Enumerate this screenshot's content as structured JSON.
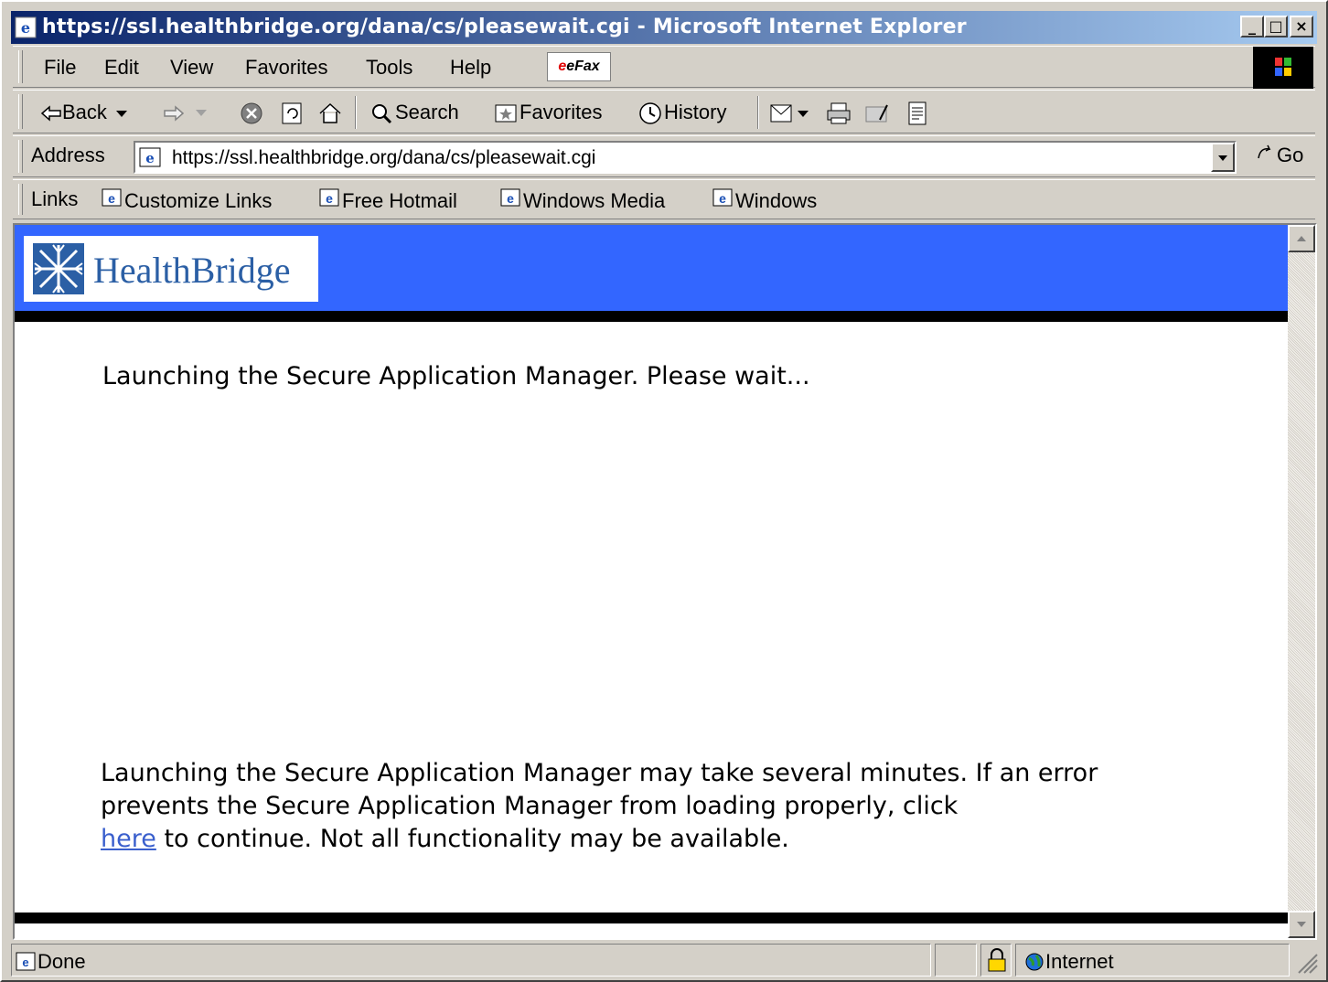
{
  "window": {
    "title": "https://ssl.healthbridge.org/dana/cs/pleasewait.cgi - Microsoft Internet Explorer",
    "controls": {
      "minimize": "_",
      "maximize": "□",
      "close": "×"
    }
  },
  "menu": {
    "items": [
      "File",
      "Edit",
      "View",
      "Favorites",
      "Tools",
      "Help"
    ],
    "efax_label": "eFax"
  },
  "toolbar": {
    "back": "Back",
    "search": "Search",
    "favorites": "Favorites",
    "history": "History"
  },
  "address": {
    "label": "Address",
    "url": "https://ssl.healthbridge.org/dana/cs/pleasewait.cgi",
    "go": "Go"
  },
  "links": {
    "label": "Links",
    "items": [
      "Customize Links",
      "Free Hotmail",
      "Windows Media",
      "Windows"
    ]
  },
  "page": {
    "logo_text": "HealthBridge",
    "message": "Launching the Secure Application Manager. Please wait...",
    "note_before": "Launching the Secure Application Manager may take several minutes. If an error prevents the Secure Application Manager from loading properly, click",
    "note_link": "here",
    "note_after": "to continue. Not all functionality may be available."
  },
  "status": {
    "text": "Done",
    "zone": "Internet"
  },
  "colors": {
    "banner": "#3366ff",
    "titlebar_start": "#0a246a",
    "link": "#3a5fcd"
  }
}
